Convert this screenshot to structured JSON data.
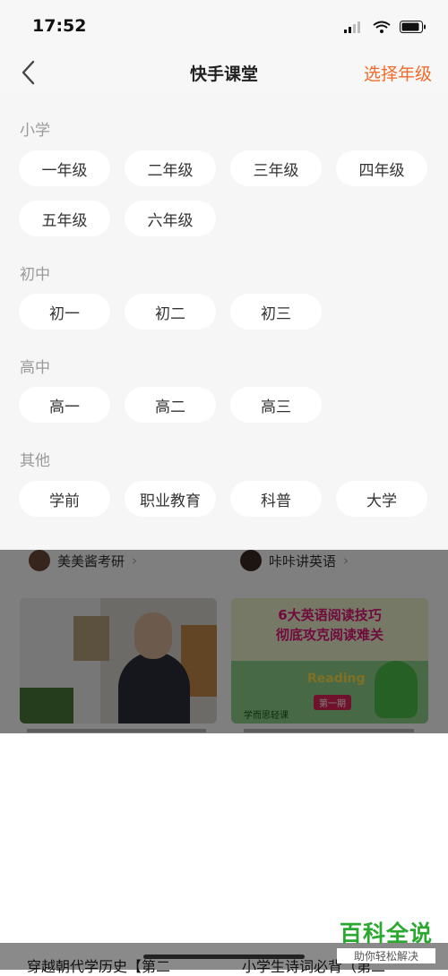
{
  "status": {
    "time": "17:52"
  },
  "nav": {
    "title": "快手课堂",
    "action": "选择年级"
  },
  "sections": [
    {
      "title": "小学",
      "items": [
        "一年级",
        "二年级",
        "三年级",
        "四年级",
        "五年级",
        "六年级"
      ]
    },
    {
      "title": "初中",
      "items": [
        "初一",
        "初二",
        "初三"
      ]
    },
    {
      "title": "高中",
      "items": [
        "高一",
        "高二",
        "高三"
      ]
    },
    {
      "title": "其他",
      "items": [
        "学前",
        "职业教育",
        "科普",
        "大学"
      ]
    }
  ],
  "feed": {
    "left_author": "美美酱考研",
    "right_author": "咔咔讲英语",
    "right_thumb_text": [
      "6大英语阅读技巧",
      "彻底攻克阅读难关",
      "Reading",
      "第一期",
      "学而思轻课"
    ],
    "left_bottom_title": "穿越朝代学历史【第二",
    "right_bottom_title": "小学生诗词必背（第二"
  },
  "watermark": {
    "main": "百科全说",
    "sub": "助你轻松解决"
  },
  "colors": {
    "accent": "#f26b2a",
    "chip_bg": "#ffffff",
    "panel_bg": "#f6f6f6",
    "watermark": "#2aa830"
  }
}
